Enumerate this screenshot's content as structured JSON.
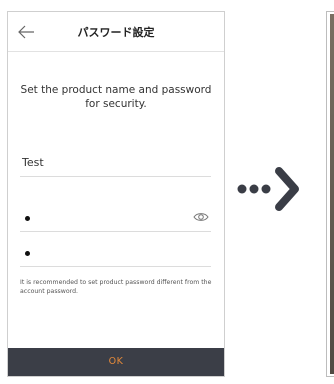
{
  "header": {
    "title": "パスワード設定"
  },
  "description": "Set the product name and password for security.",
  "product_name_field": {
    "value": "Test"
  },
  "password_field": {
    "value": "•"
  },
  "confirm_password_field": {
    "value": "•"
  },
  "hint": "It is recommended to set product password different from the account password.",
  "ok_button": {
    "label": "OK"
  },
  "icons": {
    "back": "arrow-left-icon",
    "visibility": "eye-icon",
    "next_step": "dotted-arrow-right-icon"
  },
  "colors": {
    "ok_bar_background": "#3b3e47",
    "ok_label": "#e58a3a",
    "arrow": "#3a3d46"
  }
}
